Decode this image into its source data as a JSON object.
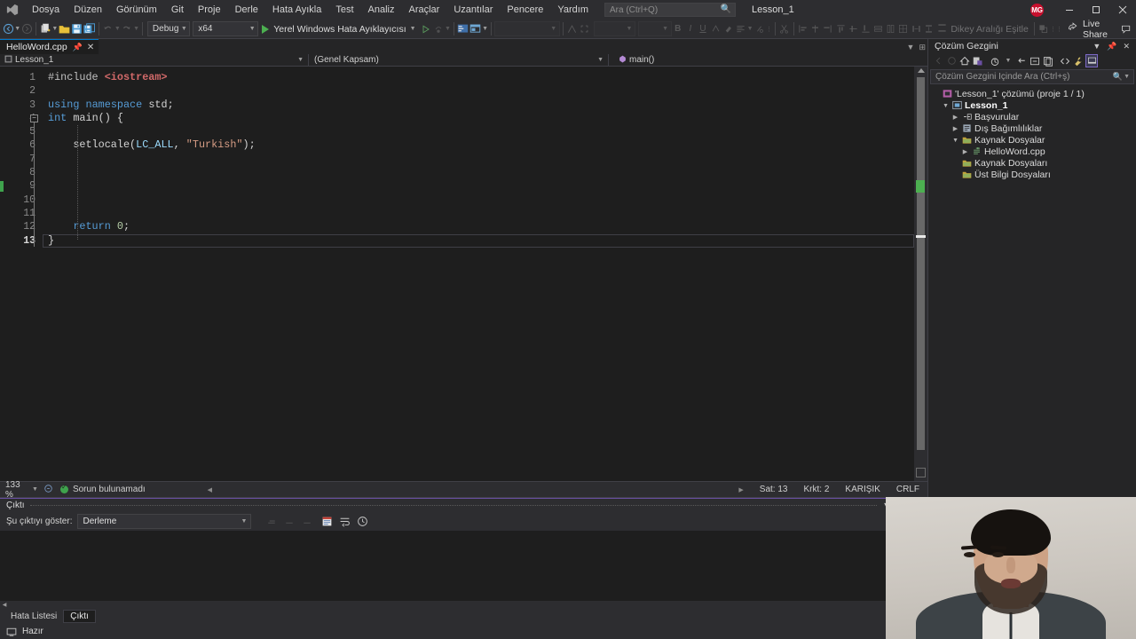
{
  "titlebar": {
    "logo_icon": "visual-studio-logo",
    "menu": [
      "Dosya",
      "Düzen",
      "Görünüm",
      "Git",
      "Proje",
      "Derle",
      "Hata Ayıkla",
      "Test",
      "Analiz",
      "Araçlar",
      "Uzantılar",
      "Pencere",
      "Yardım"
    ],
    "search_placeholder": "Ara (Ctrl+Q)",
    "search_value": "",
    "search_icon": "search-icon",
    "project_label": "Lesson_1",
    "avatar_initials": "MG",
    "avatar_color": "#c8102e",
    "minimize_icon": "minimize-icon",
    "maximize_icon": "maximize-icon",
    "close_icon": "close-icon"
  },
  "toolbar": {
    "back_icon": "navigate-back-icon",
    "forward_icon": "navigate-forward-icon",
    "new_project_icon": "new-project-icon",
    "open_icon": "open-file-icon",
    "save_icon": "save-icon",
    "save_all_icon": "save-all-icon",
    "undo_icon": "undo-icon",
    "redo_icon": "redo-icon",
    "config_value": "Debug",
    "platform_value": "x64",
    "run_label": "Yerel Windows Hata Ayıklayıcısı",
    "run_icon": "play-icon",
    "attach_icon": "attach-process-icon",
    "solution_icon": "solution-config-icon",
    "layout_icon": "window-layout-icon",
    "style_value": "",
    "font_value": "",
    "size_value": "",
    "bold_label": "B",
    "italic_label": "I",
    "underline_label": "U",
    "align_icon": "align-icon",
    "clear_format_icon": "clear-format-icon",
    "vertical_spacing_label": "Dikey Aralığı Eşitle",
    "live_share_label": "Live Share",
    "live_share_icon": "live-share-icon",
    "feedback_icon": "feedback-icon"
  },
  "editor": {
    "tab": {
      "filename": "HelloWord.cpp",
      "pin_icon": "pin-icon",
      "close_icon": "close-icon"
    },
    "navbar": {
      "project": "Lesson_1",
      "scope": "(Genel Kapsam)",
      "member": "main()",
      "project_icon": "project-icon",
      "member_icon": "method-icon"
    },
    "line_count": 13,
    "current_line": 13,
    "change_marker_line": 9,
    "lines": [
      {
        "n": 1,
        "tokens": [
          {
            "t": "#include ",
            "c": "k-pre"
          },
          {
            "t": "<iostream>",
            "c": "k-hdr"
          }
        ]
      },
      {
        "n": 2,
        "tokens": []
      },
      {
        "n": 3,
        "tokens": [
          {
            "t": "using",
            "c": "k-kw"
          },
          {
            "t": " ",
            "c": "k-punc"
          },
          {
            "t": "namespace",
            "c": "k-kw"
          },
          {
            "t": " ",
            "c": "k-punc"
          },
          {
            "t": "std",
            "c": "k-id"
          },
          {
            "t": ";",
            "c": "k-punc"
          }
        ]
      },
      {
        "n": 4,
        "tokens": [
          {
            "t": "int",
            "c": "k-kw"
          },
          {
            "t": " ",
            "c": "k-punc"
          },
          {
            "t": "main",
            "c": "k-id"
          },
          {
            "t": "() {",
            "c": "k-punc"
          }
        ],
        "fold": true
      },
      {
        "n": 5,
        "tokens": []
      },
      {
        "n": 6,
        "tokens": [
          {
            "t": "    setlocale",
            "c": "k-id"
          },
          {
            "t": "(",
            "c": "k-punc"
          },
          {
            "t": "LC_ALL",
            "c": "k-mac"
          },
          {
            "t": ", ",
            "c": "k-punc"
          },
          {
            "t": "\"Turkish\"",
            "c": "k-str"
          },
          {
            "t": ");",
            "c": "k-punc"
          }
        ]
      },
      {
        "n": 7,
        "tokens": []
      },
      {
        "n": 8,
        "tokens": []
      },
      {
        "n": 9,
        "tokens": []
      },
      {
        "n": 10,
        "tokens": []
      },
      {
        "n": 11,
        "tokens": []
      },
      {
        "n": 12,
        "tokens": [
          {
            "t": "    return",
            "c": "k-kw"
          },
          {
            "t": " ",
            "c": "k-punc"
          },
          {
            "t": "0",
            "c": "k-num"
          },
          {
            "t": ";",
            "c": "k-punc"
          }
        ]
      },
      {
        "n": 13,
        "tokens": [
          {
            "t": "}",
            "c": "k-punc"
          }
        ]
      }
    ]
  },
  "editor_status": {
    "zoom": "133 %",
    "problem_text": "Sorun bulunamadı",
    "ok_icon": "check-circle-icon",
    "line_label": "Sat: 13",
    "col_label": "Krkt: 2",
    "encoding_label": "KARIŞIK",
    "eol_label": "CRLF"
  },
  "output_panel": {
    "title": "Çıktı",
    "dropdown_label": "Şu çıktıyı göster:",
    "source_value": "Derleme",
    "content": "",
    "buttons": [
      "clear-output-icon",
      "toggle-wordwrap-icon",
      "history-icon"
    ],
    "nav_icons": [
      "find-prev-icon",
      "find-next-icon",
      "goto-icon"
    ],
    "float_icon": "float-icon",
    "pin_icon": "pin-icon",
    "close_icon": "close-icon"
  },
  "bottom_tabs": [
    {
      "label": "Hata Listesi",
      "selected": false
    },
    {
      "label": "Çıktı",
      "selected": true
    }
  ],
  "statusbar": {
    "ready_label": "Hazır",
    "ready_icon": "source-control-icon"
  },
  "solution_explorer": {
    "title": "Çözüm Gezgini",
    "dropdown_icon": "chevron-down-icon",
    "pin_icon": "pin-icon",
    "close_icon": "close-icon",
    "toolbar_icons": [
      "back-icon",
      "forward-icon",
      "home-icon",
      "pending-changes-icon",
      "sync-icon",
      "refresh-icon",
      "collapse-all-icon",
      "properties-icon",
      "show-all-files-icon",
      "code-view-icon",
      "properties-wrench-icon",
      "preview-icon"
    ],
    "search_placeholder": "Çözüm Gezgini İçinde Ara (Ctrl+ş)",
    "search_value": "",
    "search_icon": "search-icon",
    "tree": [
      {
        "label": "'Lesson_1' çözümü (proje 1 / 1)",
        "depth": 0,
        "twisty": "none",
        "icon": "solution-icon",
        "bold": false
      },
      {
        "label": "Lesson_1",
        "depth": 1,
        "twisty": "expanded",
        "icon": "cpp-project-icon",
        "bold": true
      },
      {
        "label": "Başvurular",
        "depth": 2,
        "twisty": "collapsed",
        "icon": "references-icon",
        "bold": false
      },
      {
        "label": "Dış Bağımlılıklar",
        "depth": 2,
        "twisty": "collapsed",
        "icon": "external-deps-icon",
        "bold": false
      },
      {
        "label": "Kaynak Dosyalar",
        "depth": 2,
        "twisty": "expanded",
        "icon": "folder-icon",
        "bold": false
      },
      {
        "label": "HelloWord.cpp",
        "depth": 3,
        "twisty": "collapsed",
        "icon": "cpp-file-icon",
        "bold": false
      },
      {
        "label": "Kaynak Dosyaları",
        "depth": 2,
        "twisty": "none",
        "icon": "folder-icon",
        "bold": false
      },
      {
        "label": "Üst Bilgi Dosyaları",
        "depth": 2,
        "twisty": "none",
        "icon": "folder-icon",
        "bold": false
      }
    ]
  },
  "webcam": {
    "description": "webcam-overlay"
  },
  "colors": {
    "accent": "#007acc",
    "chrome": "#2d2d30",
    "editor_bg": "#1e1e1e",
    "panel_bg": "#252526",
    "ok_green": "#3fa34d",
    "output_accent": "#6a4fa3"
  }
}
